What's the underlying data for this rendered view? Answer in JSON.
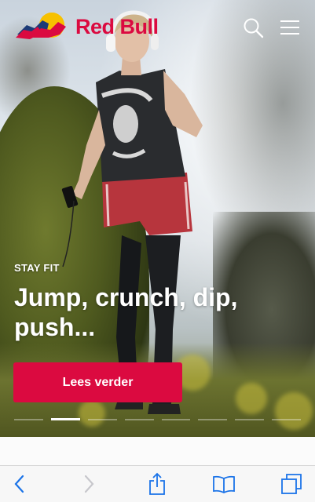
{
  "brand": {
    "name": "Red Bull",
    "color": "#db0a40"
  },
  "header": {
    "search_icon": "search-icon",
    "menu_icon": "hamburger-menu-icon"
  },
  "hero": {
    "eyebrow": "STAY FIT",
    "headline": "Jump, crunch, dip, push...",
    "cta_label": "Lees verder",
    "slides_total": 8,
    "active_slide": 2
  },
  "browser_toolbar": {
    "back_icon": "chevron-left-icon",
    "forward_icon": "chevron-right-icon",
    "share_icon": "share-icon",
    "bookmarks_icon": "book-icon",
    "tabs_icon": "tabs-icon"
  }
}
